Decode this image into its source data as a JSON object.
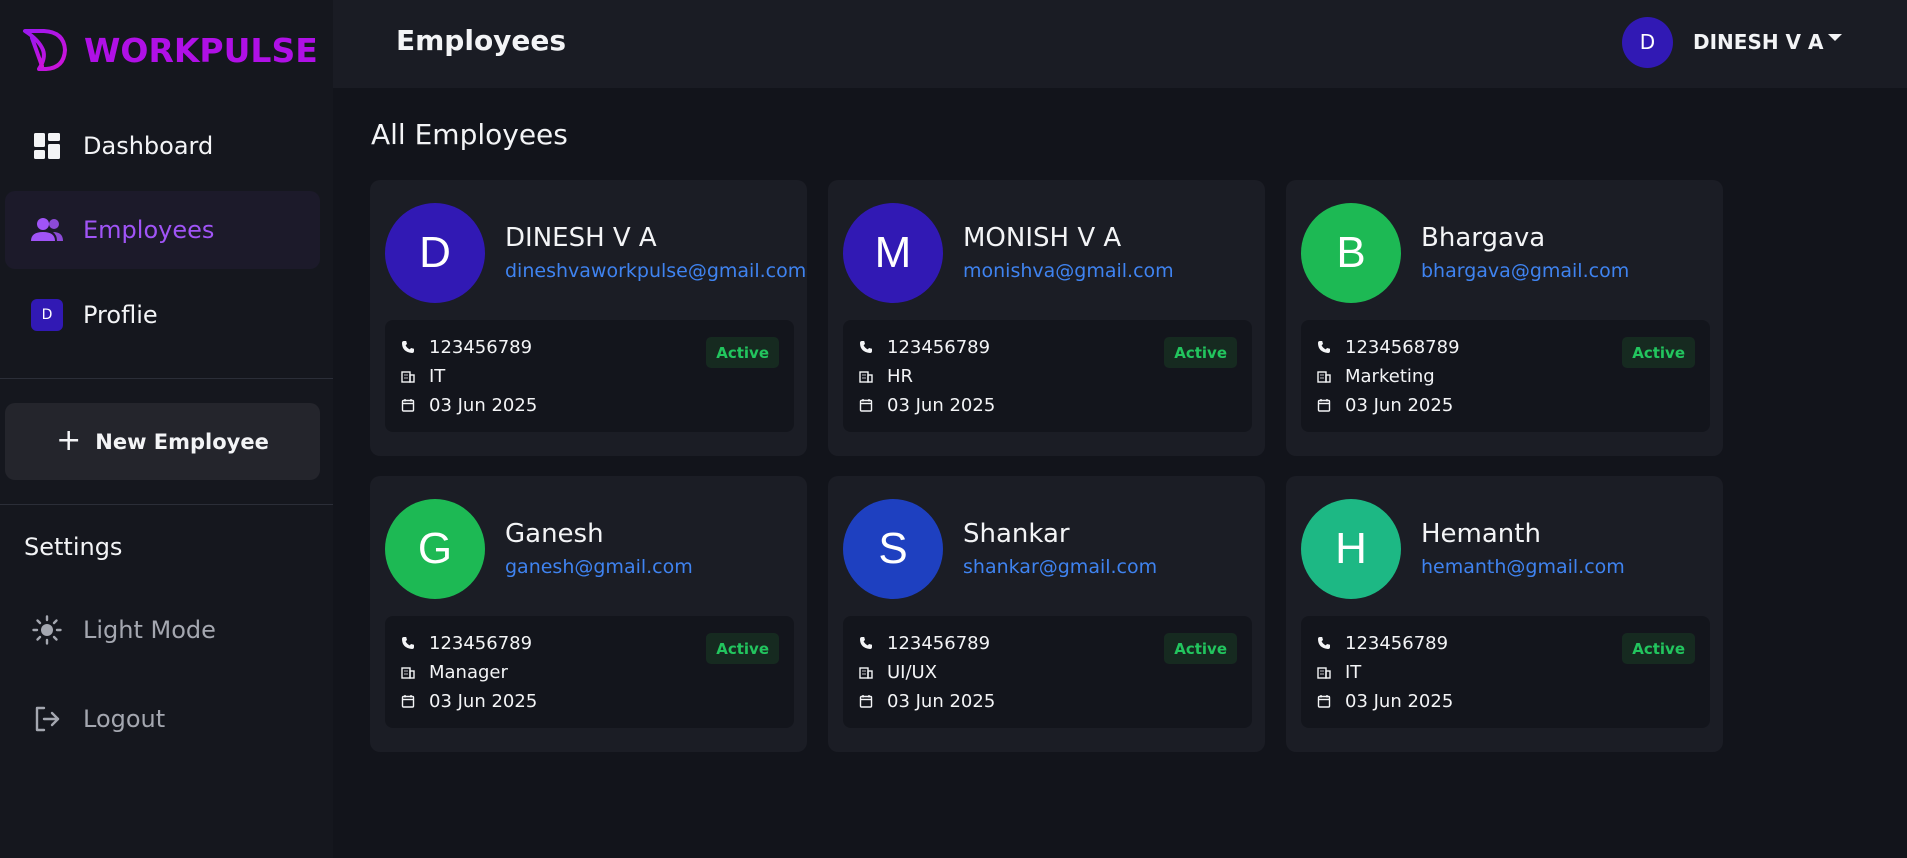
{
  "brand": {
    "name": "WORKPULSE",
    "color": "#b010e6"
  },
  "sidebar": {
    "items": [
      {
        "label": "Dashboard",
        "icon": "dashboard-icon",
        "active": false
      },
      {
        "label": "Employees",
        "icon": "users-icon",
        "active": true
      },
      {
        "label": "Proflie",
        "icon": "profile-badge-icon",
        "badge": "D",
        "active": false
      }
    ],
    "new_employee_label": "New Employee",
    "settings_title": "Settings",
    "settings_items": [
      {
        "label": "Light Mode",
        "icon": "sun-icon"
      },
      {
        "label": "Logout",
        "icon": "logout-icon"
      }
    ]
  },
  "header": {
    "title": "Employees",
    "user": {
      "initial": "D",
      "name": "DINESH V A"
    }
  },
  "main": {
    "section_title": "All Employees",
    "employees": [
      {
        "initial": "D",
        "name": "DINESH V A",
        "email": "dineshvaworkpulse@gmail.com",
        "phone": "123456789",
        "department": "IT",
        "date": "03 Jun 2025",
        "status": "Active",
        "avatar_color": "#3119b4"
      },
      {
        "initial": "M",
        "name": "MONISH V A",
        "email": "monishva@gmail.com",
        "phone": "123456789",
        "department": "HR",
        "date": "03 Jun 2025",
        "status": "Active",
        "avatar_color": "#3119b4"
      },
      {
        "initial": "B",
        "name": "Bhargava",
        "email": "bhargava@gmail.com",
        "phone": "1234568789",
        "department": "Marketing",
        "date": "03 Jun 2025",
        "status": "Active",
        "avatar_color": "#1db954"
      },
      {
        "initial": "G",
        "name": "Ganesh",
        "email": "ganesh@gmail.com",
        "phone": "123456789",
        "department": "Manager",
        "date": "03 Jun 2025",
        "status": "Active",
        "avatar_color": "#1db954"
      },
      {
        "initial": "S",
        "name": "Shankar",
        "email": "shankar@gmail.com",
        "phone": "123456789",
        "department": "UI/UX",
        "date": "03 Jun 2025",
        "status": "Active",
        "avatar_color": "#1e40c0"
      },
      {
        "initial": "H",
        "name": "Hemanth",
        "email": "hemanth@gmail.com",
        "phone": "123456789",
        "department": "IT",
        "date": "03 Jun 2025",
        "status": "Active",
        "avatar_color": "#1db884"
      }
    ]
  },
  "colors": {
    "accent": "#a054f6",
    "link": "#3f83f0",
    "status_active": "#22c55e"
  }
}
